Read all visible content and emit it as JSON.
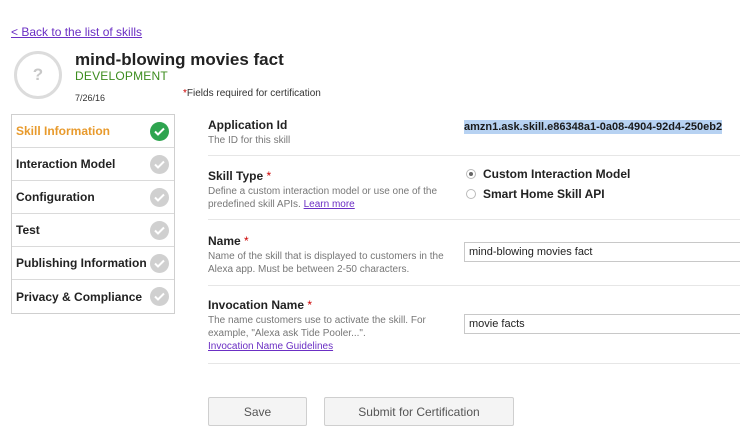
{
  "back_link": "< Back to the list of skills",
  "skill": {
    "icon_glyph": "?",
    "title": "mind-blowing movies fact",
    "stage": "DEVELOPMENT",
    "date": "7/26/16"
  },
  "required_note": {
    "asterisk": "*",
    "text": "Fields required for certification"
  },
  "nav": {
    "items": [
      {
        "label": "Skill Information",
        "active": true,
        "complete": true
      },
      {
        "label": "Interaction Model",
        "active": false,
        "complete": false
      },
      {
        "label": "Configuration",
        "active": false,
        "complete": false
      },
      {
        "label": "Test",
        "active": false,
        "complete": false
      },
      {
        "label": "Publishing Information",
        "active": false,
        "complete": false
      },
      {
        "label": "Privacy & Compliance",
        "active": false,
        "complete": false
      }
    ]
  },
  "fields": {
    "application_id": {
      "label": "Application Id",
      "desc": "The ID for this skill",
      "value": "amzn1.ask.skill.e86348a1-0a08-4904-92d4-250eb2"
    },
    "skill_type": {
      "label": "Skill Type",
      "required": "*",
      "desc": "Define a custom interaction model or use one of the predefined skill APIs.",
      "learn_more": "Learn more",
      "options": [
        "Custom Interaction Model",
        "Smart Home Skill API"
      ],
      "selected": "Custom Interaction Model"
    },
    "name": {
      "label": "Name",
      "required": "*",
      "desc": "Name of the skill that is displayed to customers in the Alexa app. Must be between 2-50 characters.",
      "value": "mind-blowing movies fact"
    },
    "invocation_name": {
      "label": "Invocation Name",
      "required": "*",
      "desc": "The name customers use to activate the skill. For example, \"Alexa ask Tide Pooler...\".",
      "guidelines": "Invocation Name Guidelines",
      "value": "movie facts"
    }
  },
  "buttons": {
    "save": "Save",
    "submit": "Submit for Certification"
  },
  "colors": {
    "active_nav": "#e89a2c",
    "stage_green": "#3c8c1e",
    "check_done": "#2ea44f",
    "check_pending": "#d0d0d0",
    "link_purple": "#6b2fc4",
    "required_red": "#cc0000",
    "selection_blue": "#b7d2f2"
  }
}
